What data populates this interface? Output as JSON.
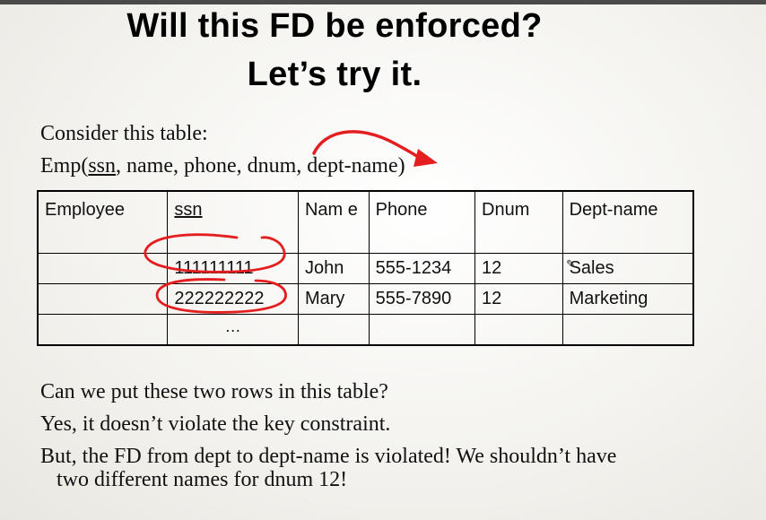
{
  "slide": {
    "title_line1": "Will this FD be enforced?",
    "title_line2": "Let’s try it.",
    "consider": "Consider this table:",
    "emp": {
      "prefix": "Emp(",
      "key": "ssn",
      "rest": ", name, phone, dnum, dept-name)"
    },
    "table": {
      "headers": [
        "Employee",
        "ssn",
        "Nam e",
        "Phone",
        "Dnum",
        "Dept-name"
      ],
      "rows": [
        [
          "",
          "111111111",
          "John",
          "555-1234",
          "12",
          "Sales"
        ],
        [
          "",
          "222222222",
          "Mary",
          "555-7890",
          "12",
          "Marketing"
        ],
        [
          "",
          "…",
          "",
          "",
          "",
          ""
        ]
      ]
    },
    "question": "Can we put these two rows in this table?",
    "answer": "Yes, it doesn’t violate the key constraint.",
    "conclusion_line1": "But, the FD from dept to dept-name is violated!  We shouldn’t have",
    "conclusion_line2": "two different names for dnum 12!"
  },
  "annotations": {
    "ink_color": "#e41e1e",
    "marks": [
      "arrow from name to dept-name",
      "circle around 111111111",
      "circle around 222222222"
    ]
  }
}
